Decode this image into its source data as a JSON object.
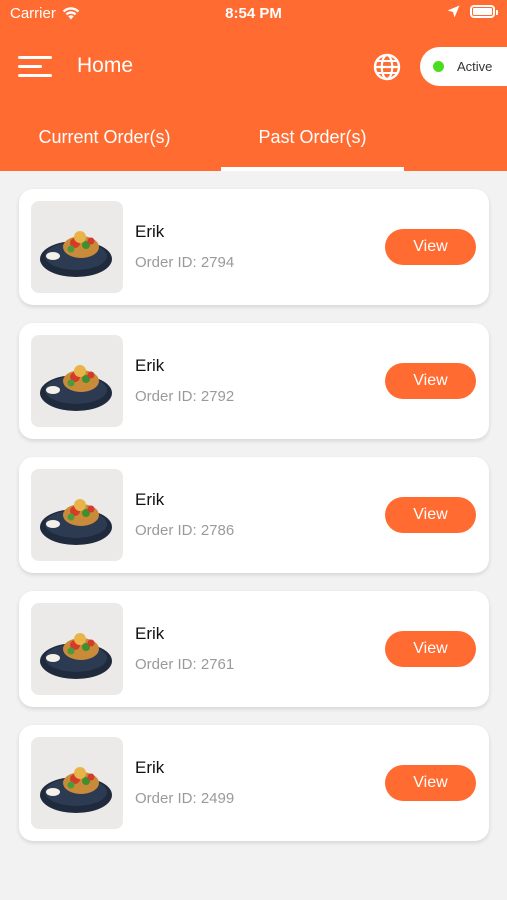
{
  "status_bar": {
    "carrier": "Carrier",
    "time": "8:54 PM"
  },
  "header": {
    "title": "Home",
    "status_label": "Active",
    "status_color": "#4cdc1e",
    "brand_color": "#ff6b30"
  },
  "tabs": [
    {
      "label": "Current Order(s)",
      "selected": false
    },
    {
      "label": "Past Order(s)",
      "selected": true
    }
  ],
  "orders": [
    {
      "name": "Erik",
      "order_id": "Order ID: 2794",
      "action": "View"
    },
    {
      "name": "Erik",
      "order_id": "Order ID: 2792",
      "action": "View"
    },
    {
      "name": "Erik",
      "order_id": "Order ID: 2786",
      "action": "View"
    },
    {
      "name": "Erik",
      "order_id": "Order ID: 2761",
      "action": "View"
    },
    {
      "name": "Erik",
      "order_id": "Order ID: 2499",
      "action": "View"
    }
  ],
  "icons": {
    "menu": "hamburger-menu-icon",
    "language": "globe-icon",
    "wifi": "wifi-icon",
    "location": "location-arrow-icon",
    "battery": "battery-icon",
    "order_image": "food-dish-image"
  }
}
